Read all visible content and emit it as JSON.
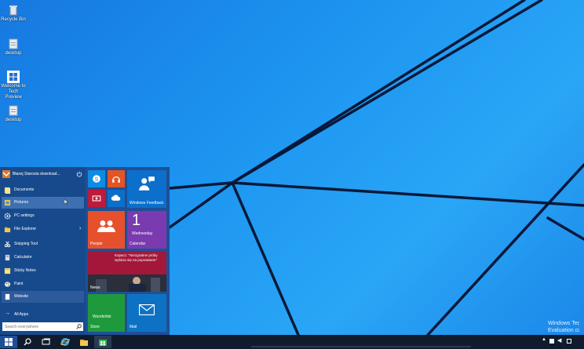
{
  "desktop": {
    "icons": [
      {
        "label": "Recycle Bin",
        "icon": "recycle-bin-icon"
      },
      {
        "label": "desktop",
        "icon": "file-icon"
      },
      {
        "label": "Welcome to Tech Preview",
        "icon": "windows-logo-icon"
      },
      {
        "label": "desktop",
        "icon": "file-icon"
      }
    ]
  },
  "start_menu": {
    "user_name": "Błażej Starosta download...",
    "items": [
      {
        "label": "Documents",
        "icon": "documents-icon",
        "has_arrow": false
      },
      {
        "label": "Pictures",
        "icon": "pictures-icon",
        "has_arrow": false
      },
      {
        "label": "PC settings",
        "icon": "gear-icon",
        "has_arrow": false
      },
      {
        "label": "File Explorer",
        "icon": "folder-icon",
        "has_arrow": true
      },
      {
        "label": "Snipping Tool",
        "icon": "scissors-icon",
        "has_arrow": false
      },
      {
        "label": "Calculator",
        "icon": "calculator-icon",
        "has_arrow": false
      },
      {
        "label": "Sticky Notes",
        "icon": "sticky-note-icon",
        "has_arrow": false
      },
      {
        "label": "Paint",
        "icon": "paint-icon",
        "has_arrow": false
      },
      {
        "label": "Website",
        "icon": "page-icon",
        "has_arrow": false
      }
    ],
    "all_apps_label": "All Apps",
    "search_placeholder": "Search everywhere",
    "tiles": {
      "windows_feedback": "Windows Feedback",
      "people": "People",
      "calendar_day": "1",
      "calendar_weekday": "Wednesday",
      "calendar": "Calendar",
      "news_headline": "Kopacz: \"Niezgrabne próby wybicia się na poprawiane\"",
      "news": "News",
      "store_sub": "Wunderlist",
      "store": "Store",
      "mail": "Mail"
    }
  },
  "watermark": {
    "line1": "Windows Technical Preview",
    "line2": "Evaluation copy."
  },
  "colors": {
    "start_bg": "#1f4f96",
    "skype": "#0c8ce2",
    "music": "#e15526",
    "video": "#bf1a3c",
    "people": "#e7502d",
    "calendar": "#7a3ab0",
    "news": "#a3173b",
    "store": "#1e9a3c",
    "mail": "#0e72c4",
    "feedback": "#0b6fcb"
  }
}
